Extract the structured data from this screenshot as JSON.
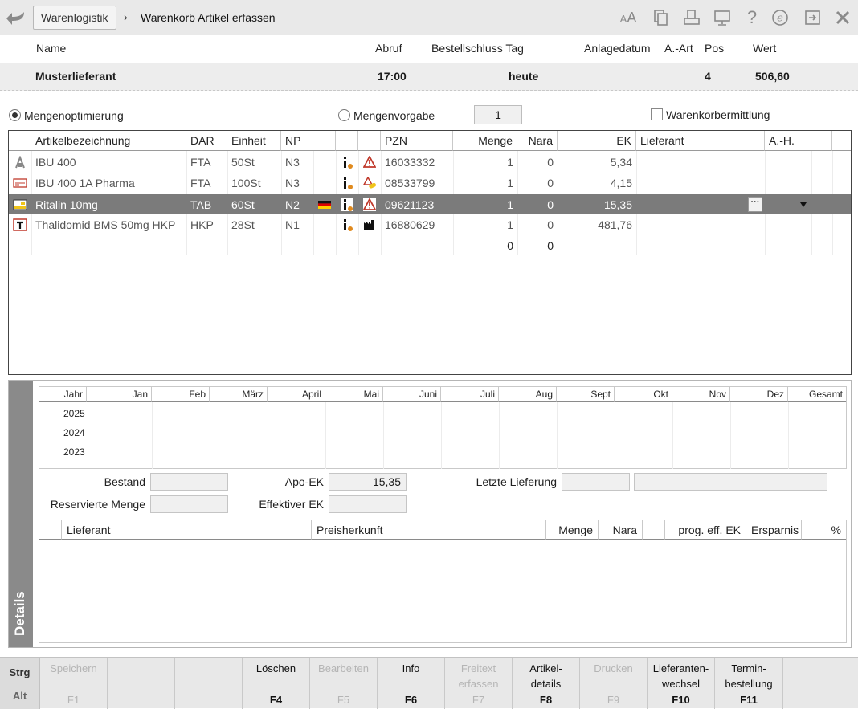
{
  "titlebar": {
    "breadcrumb_parent": "Warenlogistik",
    "separator": "›",
    "title": "Warenkorb Artikel erfassen",
    "icons": [
      "back-arrow-icon",
      "font-size-icon",
      "clipboard-icon",
      "print-icon",
      "monitor-icon",
      "help-icon",
      "e-icon",
      "exit-screen-icon",
      "close-icon"
    ]
  },
  "supplier": {
    "labels": {
      "name": "Name",
      "abruf": "Abruf",
      "bestellschluss": "Bestellschluss Tag",
      "anlagedatum": "Anlagedatum",
      "art": "A.-Art",
      "pos": "Pos",
      "wert": "Wert"
    },
    "values": {
      "name": "Musterlieferant",
      "abruf": "17:00",
      "tag": "heute",
      "pos": "4",
      "wert": "506,60"
    }
  },
  "options": {
    "mengenoptimierung": "Mengenoptimierung",
    "mengenvorgabe": "Mengenvorgabe",
    "mengenvorgabe_value": "1",
    "warenkorbermittlung": "Warenkorbermittlung",
    "selected": "mengenoptimierung"
  },
  "table": {
    "headers": {
      "bez": "Artikelbezeichnung",
      "dar": "DAR",
      "einheit": "Einheit",
      "np": "NP",
      "pzn": "PZN",
      "menge": "Menge",
      "nara": "Nara",
      "ek": "EK",
      "lieferant": "Lieferant",
      "ah": "A.-H."
    },
    "rows": [
      {
        "bez": "IBU 400",
        "dar": "FTA",
        "einheit": "50St",
        "np": "N3",
        "pzn": "16033332",
        "menge": "1",
        "nara": "0",
        "ek": "5,34",
        "type_icon": "pharmacy-a-icon",
        "flag": false,
        "info": true,
        "status_icon": "warning-icon"
      },
      {
        "bez": "IBU 400 1A Pharma",
        "dar": "FTA",
        "einheit": "100St",
        "np": "N3",
        "pzn": "08533799",
        "menge": "1",
        "nara": "0",
        "ek": "4,15",
        "type_icon": "package-icon",
        "flag": false,
        "info": true,
        "status_icon": "warning-pill-icon"
      },
      {
        "bez": "Ritalin 10mg",
        "dar": "TAB",
        "einheit": "60St",
        "np": "N2",
        "pzn": "09621123",
        "menge": "1",
        "nara": "0",
        "ek": "15,35",
        "type_icon": "btm-icon",
        "flag": true,
        "info": true,
        "status_icon": "warning-icon"
      },
      {
        "bez": "Thalidomid BMS 50mg HKP",
        "dar": "HKP",
        "einheit": "28St",
        "np": "N1",
        "pzn": "16880629",
        "menge": "1",
        "nara": "0",
        "ek": "481,76",
        "type_icon": "t-rezept-icon",
        "flag": false,
        "info": true,
        "status_icon": "factory-icon"
      }
    ],
    "new_row": {
      "menge": "0",
      "nara": "0"
    },
    "selected_row": 2
  },
  "details": {
    "tab_label": "Details",
    "months": [
      "Jahr",
      "Jan",
      "Feb",
      "März",
      "April",
      "Mai",
      "Juni",
      "Juli",
      "Aug",
      "Sept",
      "Okt",
      "Nov",
      "Dez",
      "Gesamt"
    ],
    "years": [
      "2025",
      "2024",
      "2023"
    ],
    "fields": {
      "bestand_label": "Bestand",
      "bestand": "",
      "reserviert_label": "Reservierte Menge",
      "reserviert": "",
      "apoek_label": "Apo-EK",
      "apoek": "15,35",
      "effek_label": "Effektiver EK",
      "effek": "",
      "letzte_label": "Letzte Lieferung",
      "letzte1": "",
      "letzte2": ""
    },
    "lieferant_headers": {
      "lieferant": "Lieferant",
      "preisherkunft": "Preisherkunft",
      "menge": "Menge",
      "nara": "Nara",
      "prog": "prog. eff. EK",
      "ersparnis": "Ersparnis",
      "pct": "%"
    }
  },
  "fkeys": {
    "modifiers": {
      "strg": "Strg",
      "alt": "Alt"
    },
    "keys": [
      {
        "label": "Speichern",
        "key": "F1",
        "enabled": false
      },
      {
        "label": "",
        "key": "",
        "enabled": false
      },
      {
        "label": "",
        "key": "",
        "enabled": false
      },
      {
        "label": "Löschen",
        "key": "F4",
        "enabled": true
      },
      {
        "label": "Bearbeiten",
        "key": "F5",
        "enabled": false
      },
      {
        "label": "Info",
        "key": "F6",
        "enabled": true
      },
      {
        "label": "Freitext erfassen",
        "key": "F7",
        "enabled": false
      },
      {
        "label": "Artikel-details",
        "key": "F8",
        "enabled": true
      },
      {
        "label": "Drucken",
        "key": "F9",
        "enabled": false
      },
      {
        "label": "Lieferanten-wechsel",
        "key": "F10",
        "enabled": true
      },
      {
        "label": "Termin-bestellung",
        "key": "F11",
        "enabled": true
      },
      {
        "label": "",
        "key": "",
        "enabled": false
      }
    ]
  }
}
